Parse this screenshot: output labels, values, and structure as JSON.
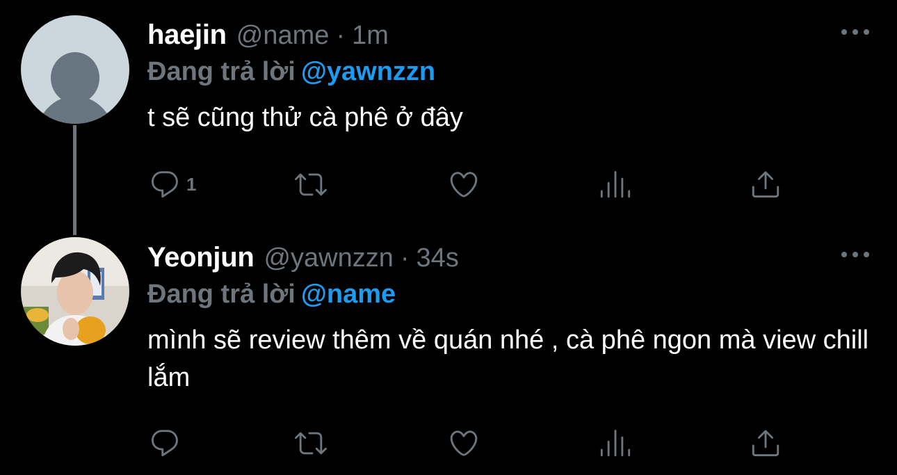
{
  "tweets": [
    {
      "display_name": "haejin",
      "handle": "@name",
      "separator": "·",
      "time": "1m",
      "reply_prefix": "Đang trả lời",
      "reply_to": "@yawnzzn",
      "text": "t sẽ cũng thử cà phê ở đây",
      "reply_count": "1",
      "avatar": "default-profile"
    },
    {
      "display_name": "Yeonjun",
      "handle": "@yawnzzn",
      "separator": "·",
      "time": "34s",
      "reply_prefix": "Đang trả lời",
      "reply_to": "@name",
      "text": "mình sẽ review thêm về quán nhé , cà phê ngon mà view chill lắm",
      "reply_count": "",
      "avatar": "photo"
    }
  ],
  "icons": [
    "reply-icon",
    "retweet-icon",
    "like-icon",
    "analytics-icon",
    "share-icon",
    "more-icon"
  ],
  "colors": {
    "background": "#000000",
    "primary_text": "#ffffff",
    "secondary_text": "#6e767d",
    "accent": "#1d9bf0"
  }
}
